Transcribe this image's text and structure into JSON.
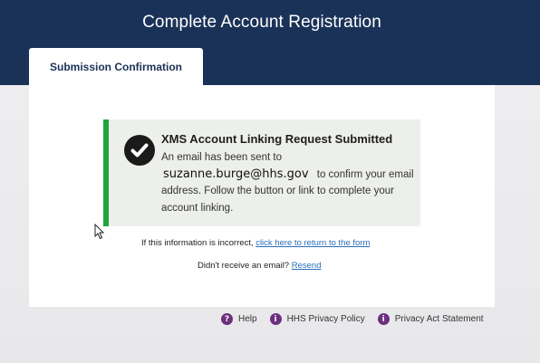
{
  "header": {
    "title": "Complete Account Registration"
  },
  "tabs": [
    {
      "label": "Submission Confirmation",
      "active": true
    }
  ],
  "notice": {
    "title": "XMS Account Linking Request Submitted",
    "body_prefix": "An email has been sent to",
    "email": "suzanne.burge@hhs.gov",
    "body_suffix": "to confirm your email address. Follow the button or link to complete your account linking.",
    "icon": "check-circle-icon",
    "accent_color": "#1fa53a"
  },
  "incorrect": {
    "text": "If this information is incorrect,",
    "link_label": "click here to return to the form"
  },
  "resend": {
    "text": "Didn't receive an email?",
    "link_label": "Resend"
  },
  "footer": {
    "links": [
      {
        "label": "Help",
        "icon": "question-icon",
        "glyph": "?"
      },
      {
        "label": "HHS Privacy Policy",
        "icon": "info-icon",
        "glyph": "i"
      },
      {
        "label": "Privacy Act Statement",
        "icon": "info-icon",
        "glyph": "i"
      }
    ]
  },
  "colors": {
    "header_bg": "#1b3258",
    "link": "#2a6ebb",
    "footer_icon": "#6d2f7f"
  }
}
